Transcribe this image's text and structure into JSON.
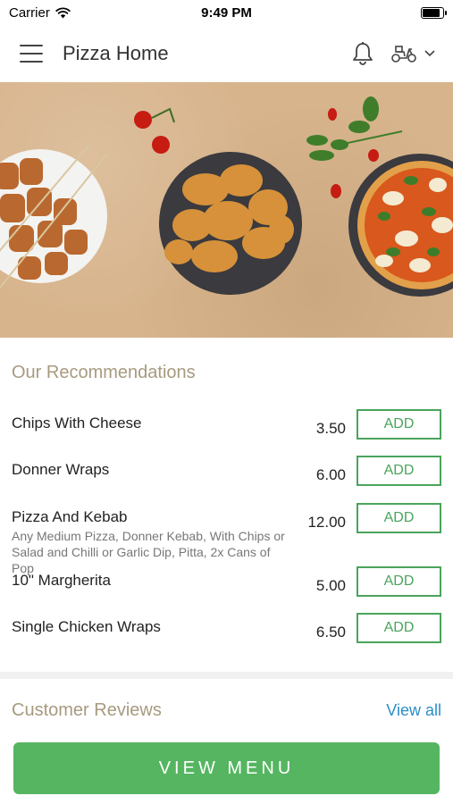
{
  "status": {
    "carrier": "Carrier",
    "time": "9:49 PM",
    "battery_level": 0.95
  },
  "header": {
    "title": "Pizza Home"
  },
  "recommendations": {
    "title": "Our Recommendations",
    "items": [
      {
        "name": "Chips With Cheese",
        "desc": "",
        "price": "3.50",
        "add_label": "ADD"
      },
      {
        "name": "Donner Wraps",
        "desc": "",
        "price": "6.00",
        "add_label": "ADD"
      },
      {
        "name": "Pizza And Kebab",
        "desc": "Any Medium Pizza, Donner Kebab, With Chips or Salad and Chilli or Garlic Dip, Pitta, 2x Cans of Pop",
        "price": "12.00",
        "add_label": "ADD"
      },
      {
        "name": "10\" Margherita",
        "desc": "",
        "price": "5.00",
        "add_label": "ADD"
      },
      {
        "name": "Single Chicken Wraps",
        "desc": "",
        "price": "6.50",
        "add_label": "ADD"
      }
    ]
  },
  "reviews": {
    "title": "Customer Reviews",
    "view_all": "View all"
  },
  "footer": {
    "view_menu": "VIEW MENU"
  },
  "colors": {
    "accent_green": "#55b560",
    "link_blue": "#2a8fc9",
    "section_title": "#a79a7f"
  }
}
